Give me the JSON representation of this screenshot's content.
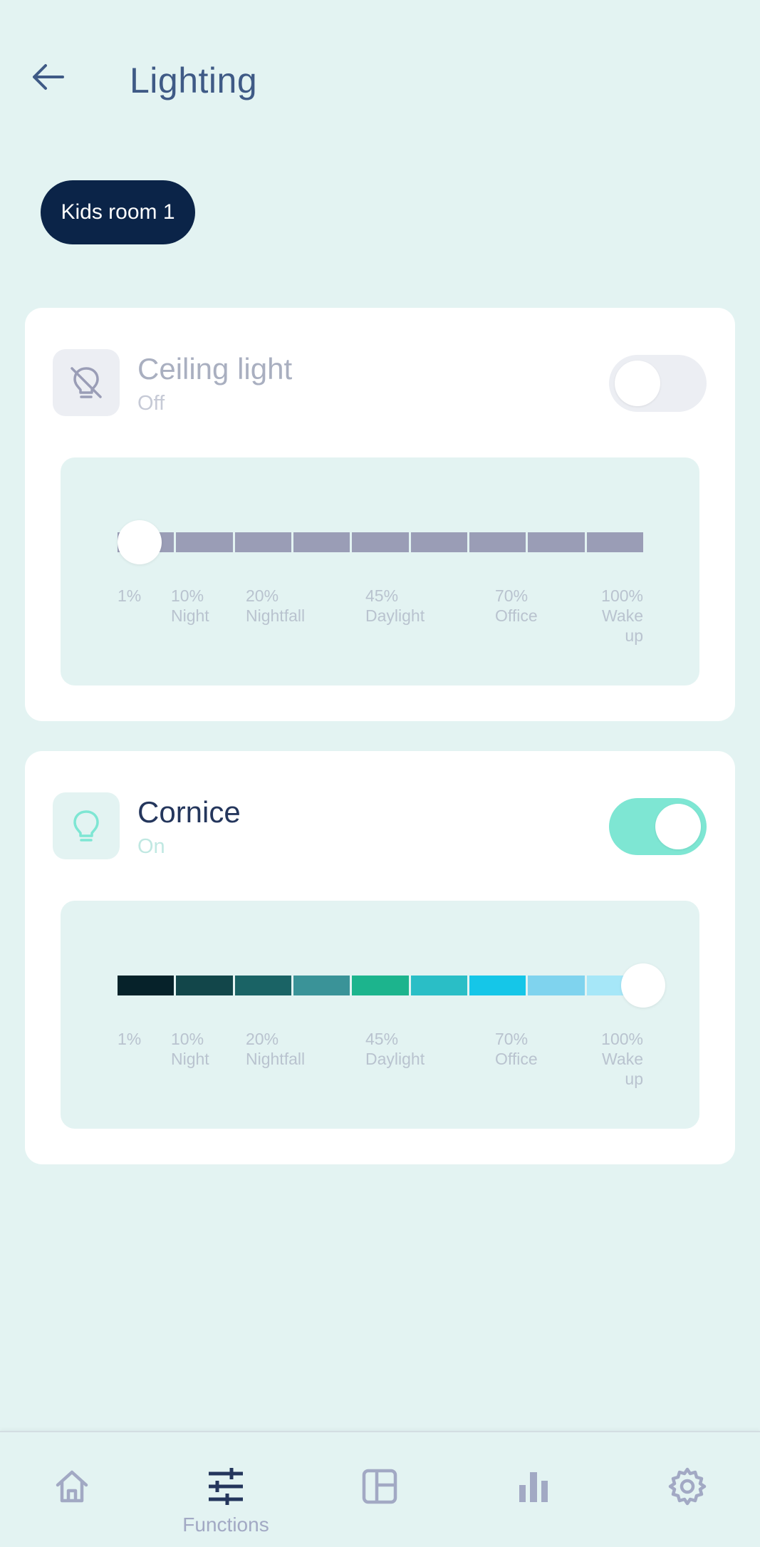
{
  "header": {
    "title": "Lighting"
  },
  "room_filter": {
    "label": "Kids room 1"
  },
  "devices": [
    {
      "name": "Ceiling light",
      "status": "Off",
      "icon": "lightbulb-off-icon",
      "on": false,
      "brightness_percent": 1,
      "segment_colors": [
        "#9a9db6",
        "#9a9db6",
        "#9a9db6",
        "#9a9db6",
        "#9a9db6",
        "#9a9db6",
        "#9a9db6",
        "#9a9db6",
        "#9a9db6"
      ],
      "labels": [
        {
          "top": "1%",
          "bottom": ""
        },
        {
          "top": "10%",
          "bottom": "Night"
        },
        {
          "top": "20%",
          "bottom": "Nightfall"
        },
        {
          "top": "45%",
          "bottom": "Daylight"
        },
        {
          "top": "70%",
          "bottom": "Office"
        },
        {
          "top": "100% Wake",
          "bottom": "up"
        }
      ]
    },
    {
      "name": "Cornice",
      "status": "On",
      "icon": "lightbulb-icon",
      "on": true,
      "brightness_percent": 100,
      "segment_colors": [
        "#06222a",
        "#12464a",
        "#1a6365",
        "#3a9398",
        "#1cb48d",
        "#2abec6",
        "#15c6e8",
        "#7fd3ee",
        "#a6e7f8"
      ],
      "labels": [
        {
          "top": "1%",
          "bottom": ""
        },
        {
          "top": "10%",
          "bottom": "Night"
        },
        {
          "top": "20%",
          "bottom": "Nightfall"
        },
        {
          "top": "45%",
          "bottom": "Daylight"
        },
        {
          "top": "70%",
          "bottom": "Office"
        },
        {
          "top": "100% Wake",
          "bottom": "up"
        }
      ]
    }
  ],
  "bottom_nav": {
    "items": [
      {
        "icon": "home-icon",
        "label": ""
      },
      {
        "icon": "sliders-icon",
        "label": "Functions"
      },
      {
        "icon": "layout-icon",
        "label": ""
      },
      {
        "icon": "bar-chart-icon",
        "label": ""
      },
      {
        "icon": "gear-icon",
        "label": ""
      }
    ]
  },
  "colors": {
    "background": "#e3f3f2",
    "chip": "#0b2448",
    "accent": "#7ee6d3",
    "nav_active": "#24365c",
    "nav_inactive": "#a2a9c4"
  }
}
